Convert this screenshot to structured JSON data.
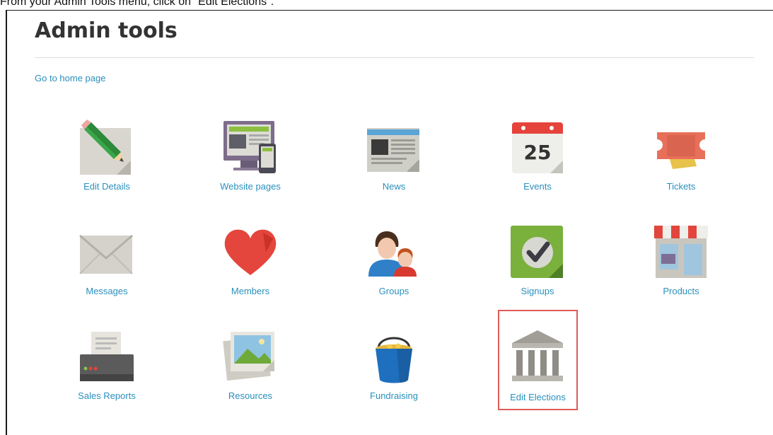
{
  "instruction": "From your Admin Tools menu, click on \"Edit Elections\".",
  "page": {
    "title": "Admin tools",
    "home_link": "Go to home page"
  },
  "tools": [
    {
      "label": "Edit Details",
      "icon": "pencil-icon"
    },
    {
      "label": "Website pages",
      "icon": "website-icon"
    },
    {
      "label": "News",
      "icon": "newspaper-icon"
    },
    {
      "label": "Events",
      "icon": "calendar-icon",
      "day": "25"
    },
    {
      "label": "Tickets",
      "icon": "ticket-icon"
    },
    {
      "label": "Messages",
      "icon": "envelope-icon"
    },
    {
      "label": "Members",
      "icon": "heart-icon"
    },
    {
      "label": "Groups",
      "icon": "people-icon"
    },
    {
      "label": "Signups",
      "icon": "checkmark-icon"
    },
    {
      "label": "Products",
      "icon": "storefront-icon"
    },
    {
      "label": "Sales Reports",
      "icon": "printer-icon"
    },
    {
      "label": "Resources",
      "icon": "photo-icon"
    },
    {
      "label": "Fundraising",
      "icon": "bucket-icon"
    },
    {
      "label": "Edit Elections",
      "icon": "building-icon",
      "highlighted": true
    }
  ],
  "colors": {
    "link": "#2a8fbd",
    "highlight_border": "#e05a5a"
  }
}
